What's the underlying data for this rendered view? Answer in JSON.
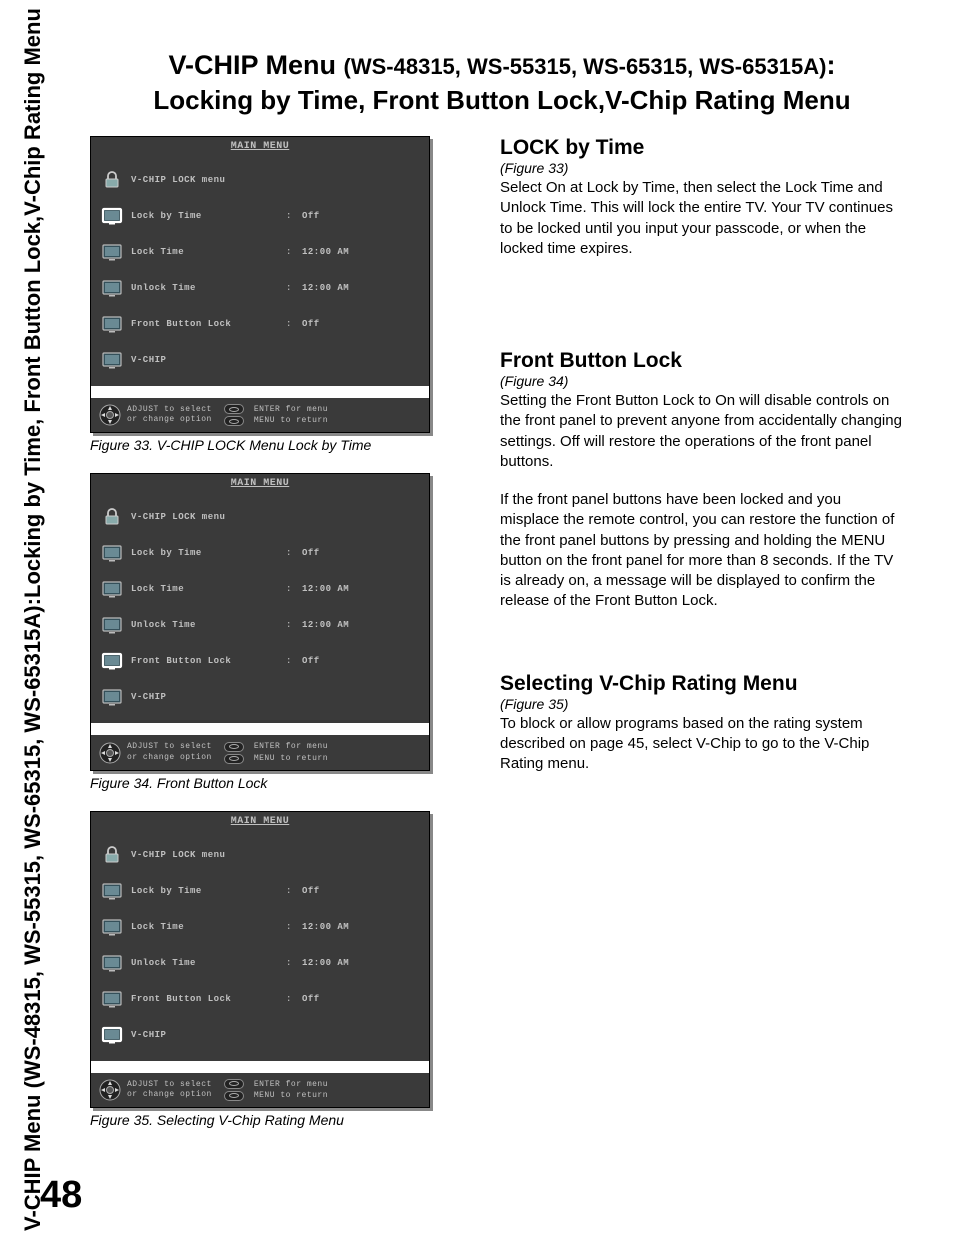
{
  "page": {
    "title_prefix": "V-CHIP Menu ",
    "title_models": "(WS-48315, WS-55315, WS-65315, WS-65315A)",
    "title_suffix": ":",
    "title_line2": "Locking by Time, Front Button Lock,V-Chip Rating Menu",
    "side_tab_line1": "V-CHIP Menu (WS-48315, WS-55315, WS-65315, WS-65315A):",
    "side_tab_line2": "Locking by Time, Front Button Lock,V-Chip Rating Menu",
    "page_number": "48"
  },
  "screenshots": {
    "main_menu_label": "MAIN MENU",
    "menu_header": "V-CHIP LOCK menu",
    "rows": [
      {
        "label": "Lock by Time",
        "value": "Off"
      },
      {
        "label": "Lock Time",
        "value": "12:00 AM"
      },
      {
        "label": "Unlock Time",
        "value": "12:00 AM"
      },
      {
        "label": "Front Button Lock",
        "value": "Off"
      },
      {
        "label": "V-CHIP",
        "value": ""
      }
    ],
    "footer": {
      "adjust_line1": "ADJUST to select",
      "adjust_line2": "or change option",
      "enter_line": "ENTER for menu",
      "menu_line": "MENU to return"
    },
    "fig33_highlight_index": 0,
    "fig34_highlight_index": 3,
    "fig35_highlight_index": 4,
    "caption33": "Figure 33.  V-CHIP LOCK Menu Lock by Time",
    "caption34": "Figure 34. Front Button Lock",
    "caption35": "Figure 35. Selecting V-Chip Rating Menu"
  },
  "sections": {
    "lock_by_time": {
      "heading": "LOCK by Time",
      "fig_ref": "(Figure 33)",
      "body": "Select On at Lock by Time, then select the Lock Time and Unlock Time.  This will lock the entire TV. Your TV continues to be locked until you input your passcode, or when the locked time expires."
    },
    "front_button_lock": {
      "heading": "Front Button Lock",
      "fig_ref": "(Figure 34)",
      "body1": "Setting the Front Button Lock to On will disable controls on the front panel to prevent anyone from accidentally changing settings.  Off will restore the operations of the front panel buttons.",
      "body2": "If the front panel buttons have been locked and you misplace the remote control, you can restore the function of the front panel buttons by pressing and holding the MENU button on the front panel for more than 8 seconds.  If the TV is already on, a message will be displayed to confirm the release of the Front Button Lock."
    },
    "vchip_rating": {
      "heading": "Selecting V-Chip Rating Menu",
      "fig_ref": "(Figure 35)",
      "body": "To block or allow programs based on the rating system described on page 45, select V-Chip to go to the  V-Chip Rating menu."
    }
  }
}
